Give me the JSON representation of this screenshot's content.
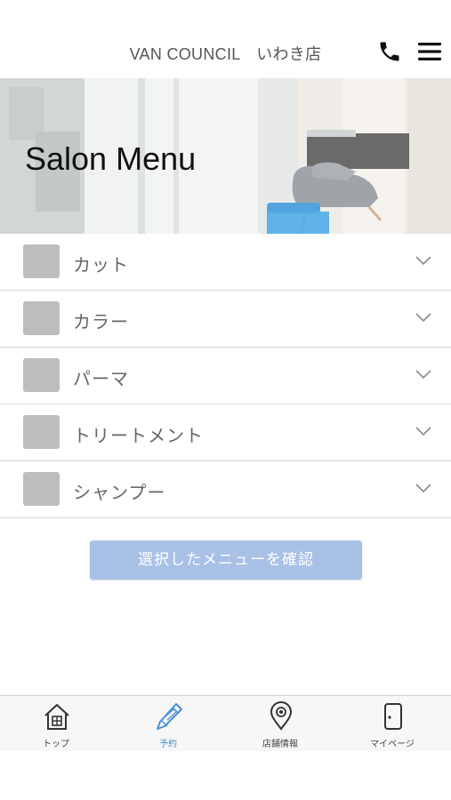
{
  "header": {
    "title": "VAN COUNCIL　いわき店"
  },
  "hero": {
    "title": "Salon Menu"
  },
  "menu": {
    "items": [
      {
        "label": "カット"
      },
      {
        "label": "カラー"
      },
      {
        "label": "パーマ"
      },
      {
        "label": "トリートメント"
      },
      {
        "label": "シャンプー"
      }
    ]
  },
  "confirm_button": {
    "label": "選択したメニューを確認"
  },
  "tabbar": {
    "tabs": [
      {
        "label": "トップ",
        "icon": "home-icon"
      },
      {
        "label": "予約",
        "icon": "pencil-icon",
        "active": true
      },
      {
        "label": "店舗情報",
        "icon": "map-pin-icon"
      },
      {
        "label": "マイページ",
        "icon": "door-icon"
      }
    ]
  },
  "colors": {
    "accent": "#4a8fd4",
    "button": "#a9c1e6",
    "thumb": "#bdbdbd"
  }
}
